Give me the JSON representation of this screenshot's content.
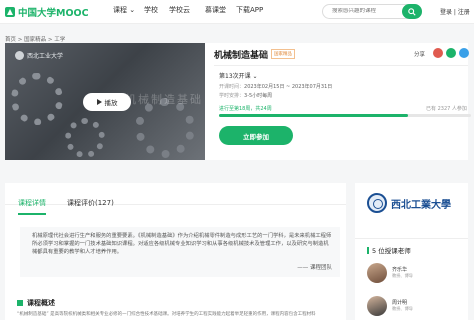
{
  "header": {
    "logo_text": "中国大学MOOC",
    "nav": [
      "课程 ⌄",
      "学校",
      "学校云",
      "慕课堂",
      "下载APP"
    ],
    "search_placeholder": "搜索感兴趣的课程",
    "login": "登录 | 注册"
  },
  "breadcrumb": "首页 > 国家精品 > 工学",
  "course": {
    "cover_school": "西北工业大学",
    "cover_watermark": "机械制造基础",
    "play_label": "播放",
    "title": "机械制造基础",
    "badge": "国家精品",
    "share_label": "分享",
    "term": "第13次开课 ⌄",
    "meta": [
      {
        "label": "开课时间：",
        "value": "2023年02月15日 ~ 2023年07月31日"
      },
      {
        "label": "学时安排：",
        "value": "3-5小时每周"
      }
    ],
    "status": "进行至第18周，共24周",
    "enrolled": "已有 2327 人参加",
    "progress": 0.75,
    "join_label": "立即参加"
  },
  "tabs": [
    {
      "label": "课程详情"
    },
    {
      "label": "课程评价(127)"
    }
  ],
  "detail": {
    "quote": "机械原理代社会进行生产和服务的重要要素。《机械制造基础》作为介绍机械零件制造与成形工艺的一门学科，是未来机械工程师所必须学习和掌握的一门技术基础知识课程。对适应各级机械专业知识学习和从事各级机械技术及管理工作，以及研究与制造机械都具有重要的教学和人才培养作用。",
    "quote_sign": "—— 课程团队",
    "overview_title": "课程概述",
    "overview_text": "“机械制造基础” 是高等院校机械类和相关专业必修的一门综合性技术基础课。对培养学生的工程实践能力起着举足轻重的作用，课程内容包含工程材料"
  },
  "sidebar": {
    "school_name": "西北工業大學",
    "teachers_title": "5 位授课老师",
    "teachers": [
      {
        "name": "齐乐华",
        "school": "教授、博导"
      },
      {
        "name": "周计明",
        "school": "教授、博导"
      }
    ]
  },
  "colors": {
    "accent": "#1cb36a",
    "school_blue": "#1b4f93"
  }
}
